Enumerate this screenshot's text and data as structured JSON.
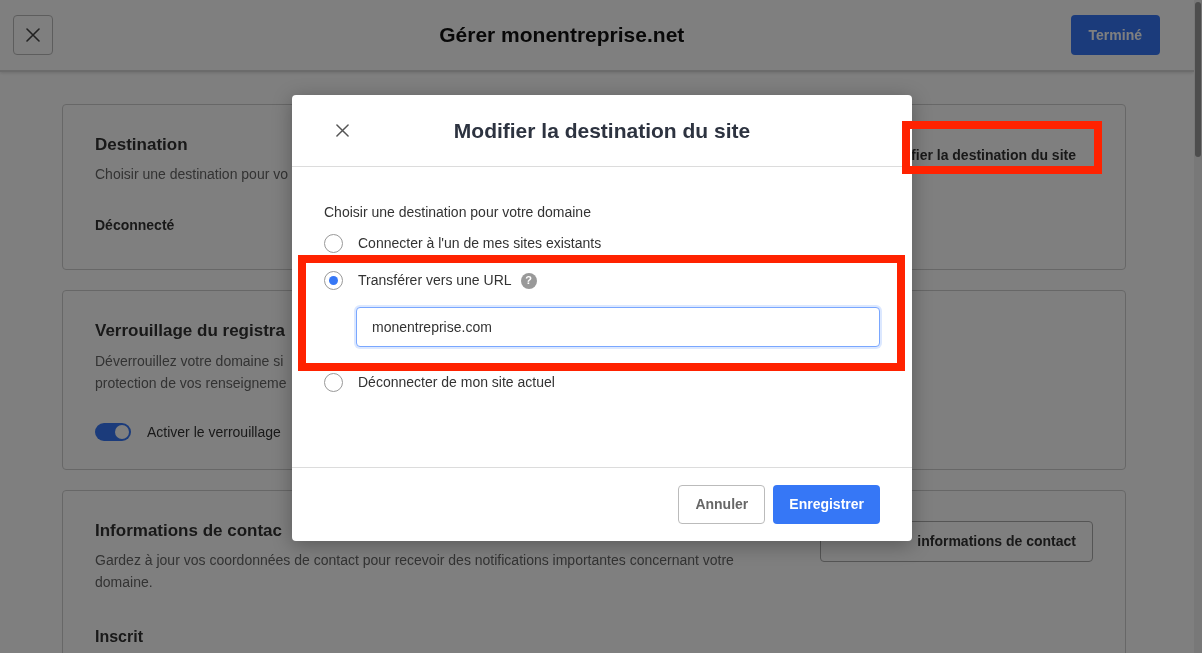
{
  "header": {
    "title": "Gérer monentreprise.net",
    "done_button": "Terminé"
  },
  "cards": [
    {
      "kind": "destination",
      "title": "Destination",
      "description_lines": [
        "Choisir une destination pour vo"
      ],
      "button": "fier la destination du site",
      "status": "Déconnecté"
    },
    {
      "kind": "lock",
      "title": "Verrouillage du registra",
      "description_lines": [
        "Déverrouillez votre domaine si",
        "protection de vos renseigneme"
      ],
      "toggle": {
        "label": "Activer le verrouillage",
        "on": true
      }
    },
    {
      "kind": "contact",
      "title": "Informations de contac",
      "description": "Gardez à jour vos coordonnées de contact pour recevoir des notifications importantes concernant votre domaine.",
      "button": "informations de contact",
      "subheading": "Inscrit"
    }
  ],
  "dialog": {
    "title": "Modifier la destination du site",
    "prompt": "Choisir une destination pour votre domaine",
    "options": [
      {
        "label": "Connecter à l'un de mes sites existants",
        "selected": false
      },
      {
        "label": "Transférer vers une URL",
        "selected": true,
        "help": "?",
        "field": {
          "value": "monentreprise.com",
          "focused": true
        }
      },
      {
        "label": "Déconnecter de mon site actuel",
        "selected": false
      }
    ],
    "cancel_button": "Annuler",
    "save_button": "Enregistrer"
  }
}
